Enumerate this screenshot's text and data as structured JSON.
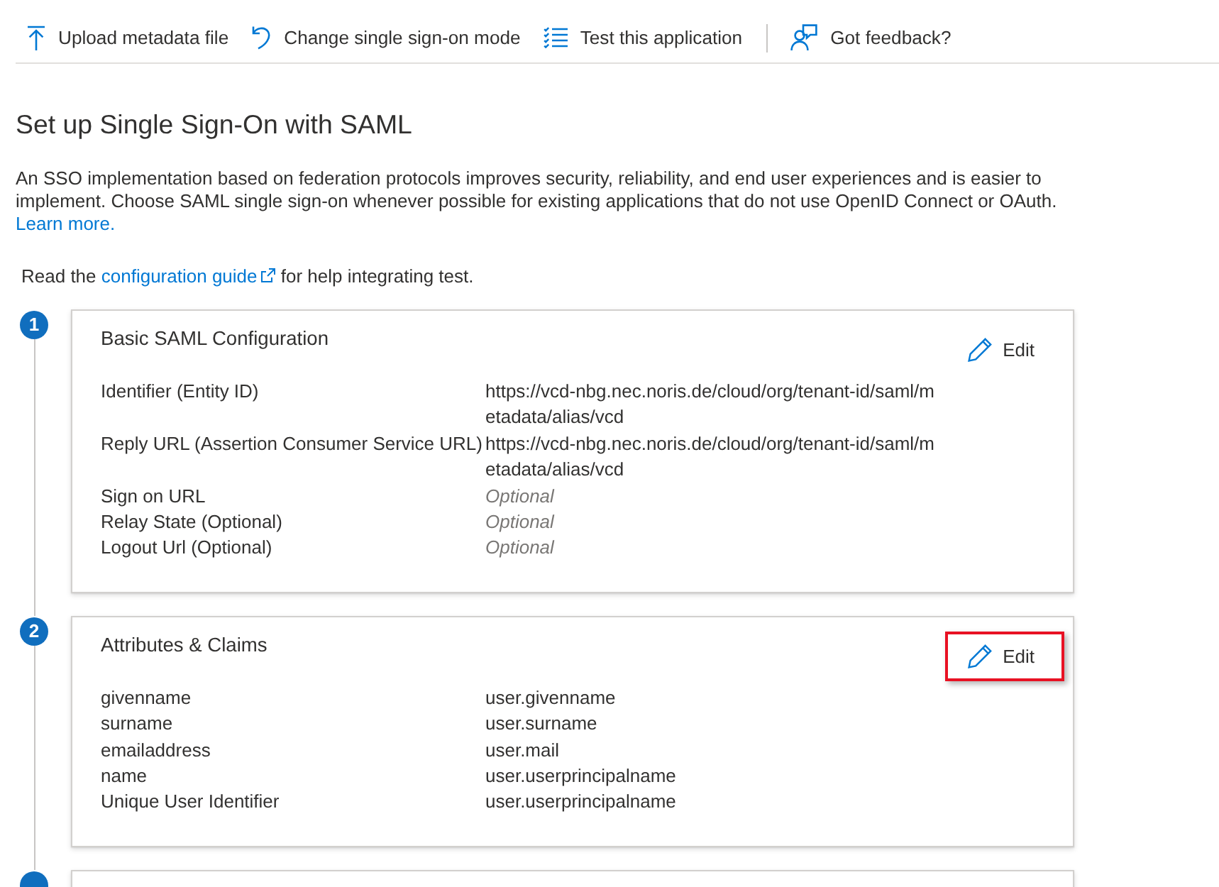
{
  "toolbar": {
    "actions": [
      {
        "label": "Upload metadata file"
      },
      {
        "label": "Change single sign-on mode"
      },
      {
        "label": "Test this application"
      }
    ],
    "feedback": {
      "label": "Got feedback?"
    }
  },
  "title": "Set up Single Sign-On with SAML",
  "intro": {
    "text": "An SSO implementation based on federation protocols improves security, reliability, and end user experiences and is easier to implement. Choose SAML single sign-on whenever possible for existing applications that do not use OpenID Connect or OAuth.",
    "link": "Learn more."
  },
  "guide_note": {
    "before": "Read the",
    "link": "configuration guide",
    "after": "for help integrating test."
  },
  "steps": [
    {
      "kind": "section",
      "number": "1",
      "title": "Basic SAML Configuration",
      "edit": {
        "label": "Edit",
        "highlighted": false
      },
      "rows": [
        {
          "label": "Identifier (Entity ID)",
          "value": "https://vcd-nbg.nec.noris.de/cloud/org/tenant-id/saml/metadata/alias/vcd"
        },
        {
          "label": "Reply URL (Assertion Consumer Service URL)",
          "value": "https://vcd-nbg.nec.noris.de/cloud/org/tenant-id/saml/metadata/alias/vcd"
        },
        {
          "label": "Sign on URL",
          "placeholder": "Optional"
        },
        {
          "label": "Relay State (Optional)",
          "placeholder": "Optional"
        },
        {
          "label": "Logout Url (Optional)",
          "placeholder": "Optional"
        }
      ]
    },
    {
      "kind": "section",
      "number": "2",
      "title": "Attributes & Claims",
      "edit": {
        "label": "Edit",
        "highlighted": true
      },
      "rows": [
        {
          "label": "givenname",
          "value": "user.givenname"
        },
        {
          "label": "surname",
          "value": "user.surname"
        },
        {
          "label": "emailaddress",
          "value": "user.mail"
        },
        {
          "label": "name",
          "value": "user.userprincipalname"
        },
        {
          "label": "Unique User Identifier",
          "value": "user.userprincipalname"
        }
      ]
    },
    {
      "kind": "cut_off"
    }
  ]
}
